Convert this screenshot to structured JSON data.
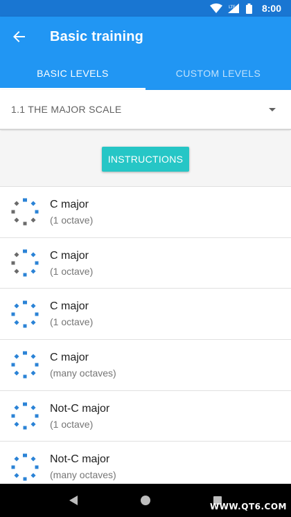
{
  "status_bar": {
    "time": "8:00",
    "network": "LTE"
  },
  "app_bar": {
    "title": "Basic training"
  },
  "tabs": [
    {
      "label": "BASIC LEVELS",
      "active": true
    },
    {
      "label": "CUSTOM LEVELS",
      "active": false
    }
  ],
  "spinner": {
    "selected": "1.1 THE MAJOR SCALE"
  },
  "instructions_button": {
    "label": "INSTRUCTIONS"
  },
  "levels": [
    {
      "name": "C major",
      "subtitle": "(1 octave)",
      "progress_segments_done": 3
    },
    {
      "name": "C major",
      "subtitle": "(1 octave)",
      "progress_segments_done": 5
    },
    {
      "name": "C major",
      "subtitle": "(1 octave)",
      "progress_segments_done": 8
    },
    {
      "name": "C major",
      "subtitle": "(many octaves)",
      "progress_segments_done": 8
    },
    {
      "name": "Not-C major",
      "subtitle": "(1 octave)",
      "progress_segments_done": 8
    },
    {
      "name": "Not-C major",
      "subtitle": "(many octaves)",
      "progress_segments_done": 8
    }
  ],
  "colors": {
    "status_bar": "#1976d2",
    "app_bar": "#2196f3",
    "accent_button": "#26c6c6",
    "progress_done": "#2b83d6",
    "progress_todo": "#6b6b6b"
  },
  "watermark": "WWW.QT6.COM"
}
